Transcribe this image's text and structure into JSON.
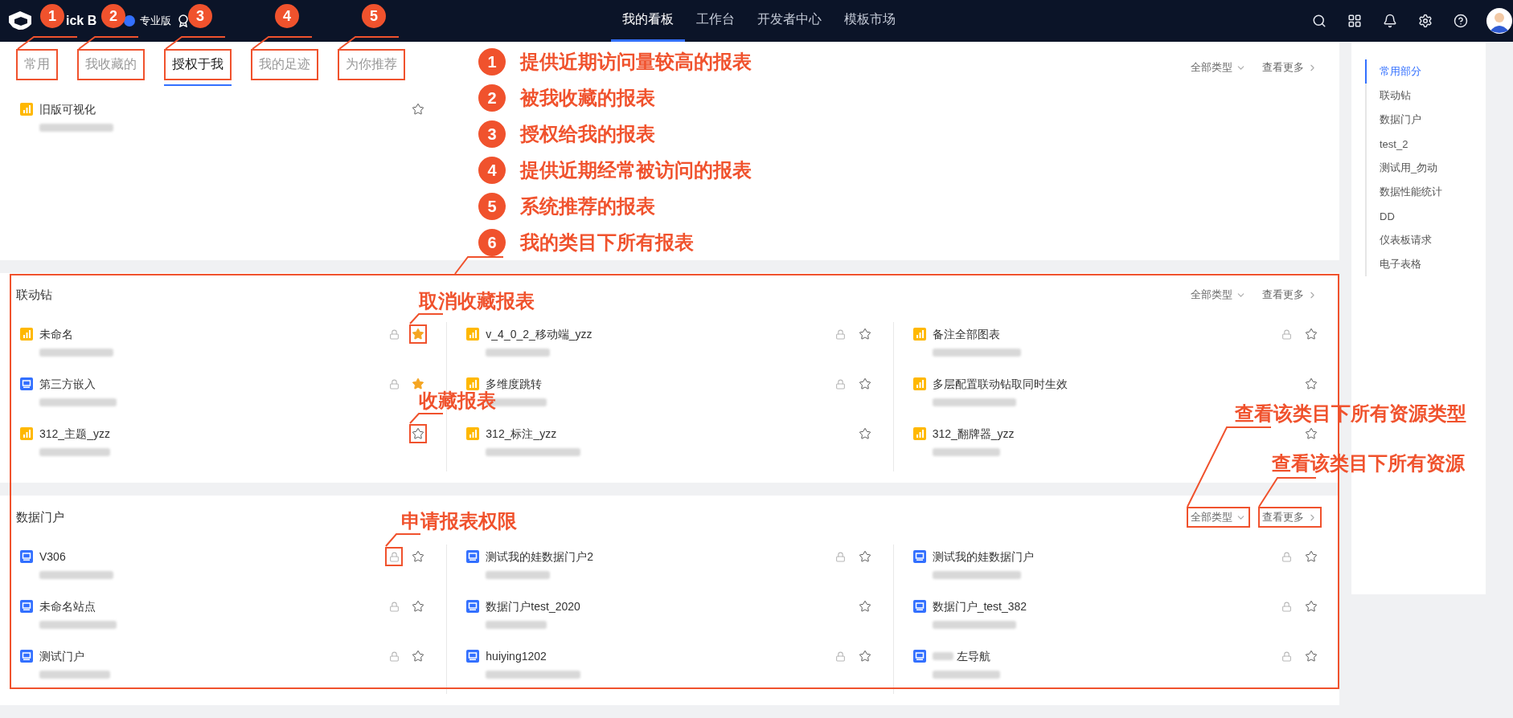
{
  "top_bar": {
    "logo_text": "ick B",
    "edition": "专业版",
    "nav": [
      {
        "label": "我的看板",
        "selected": true
      },
      {
        "label": "工作台",
        "selected": false
      },
      {
        "label": "开发者中心",
        "selected": false
      },
      {
        "label": "模板市场",
        "selected": false
      }
    ]
  },
  "common": {
    "tabs": [
      {
        "label": "常用",
        "selected": false,
        "marked": true,
        "badge": "1"
      },
      {
        "label": "我收藏的",
        "selected": false,
        "marked": true,
        "badge": "2"
      },
      {
        "label": "授权于我",
        "selected": true,
        "marked": true,
        "badge": "3"
      },
      {
        "label": "我的足迹",
        "selected": false,
        "marked": true,
        "badge": "4"
      },
      {
        "label": "为你推荐",
        "selected": false,
        "marked": true,
        "badge": "5"
      }
    ],
    "filter": {
      "label": "全部类型",
      "boxed": false
    },
    "more": {
      "label": "查看更多",
      "boxed": false
    },
    "items": [
      {
        "name": "旧版可视化",
        "kind": "chart",
        "locked": false,
        "favorite": false
      }
    ]
  },
  "legend": [
    {
      "number": "1",
      "text": "提供近期访问量较高的报表"
    },
    {
      "number": "2",
      "text": "被我收藏的报表"
    },
    {
      "number": "3",
      "text": "授权给我的报表"
    },
    {
      "number": "4",
      "text": "提供近期经常被访问的报表"
    },
    {
      "number": "5",
      "text": "系统推荐的报表"
    },
    {
      "number": "6",
      "text": "我的类目下所有报表"
    }
  ],
  "sections": [
    {
      "title": "联动钻",
      "filter": {
        "label": "全部类型",
        "boxed": false
      },
      "more": {
        "label": "查看更多",
        "boxed": false
      },
      "items": [
        {
          "name": "未命名",
          "kind": "chart",
          "locked": true,
          "favorite": true,
          "star_boxed": true,
          "callout": "取消收藏报表"
        },
        {
          "name": "v_4_0_2_移动端_yzz",
          "kind": "chart",
          "locked": true,
          "favorite": false
        },
        {
          "name": "备注全部图表",
          "kind": "chart",
          "locked": true,
          "favorite": false
        },
        {
          "name": "第三方嵌入",
          "kind": "portal",
          "locked": true,
          "favorite": true
        },
        {
          "name": "多维度跳转",
          "kind": "chart",
          "locked": true,
          "favorite": false
        },
        {
          "name": "多层配置联动钻取同时生效",
          "kind": "chart",
          "locked": false,
          "favorite": false
        },
        {
          "name": "312_主题_yzz",
          "kind": "chart",
          "locked": false,
          "favorite": false,
          "star_boxed": true,
          "callout": "收藏报表"
        },
        {
          "name": "312_标注_yzz",
          "kind": "chart",
          "locked": false,
          "favorite": false
        },
        {
          "name": "312_翻牌器_yzz",
          "kind": "chart",
          "locked": false,
          "favorite": false
        }
      ]
    },
    {
      "title": "数据门户",
      "filter": {
        "label": "全部类型",
        "boxed": true,
        "note": "查看该类目下所有资源类型"
      },
      "more": {
        "label": "查看更多",
        "boxed": true,
        "note": "查看该类目下所有资源"
      },
      "items": [
        {
          "name": "V306",
          "kind": "portal",
          "locked": true,
          "favorite": false,
          "lock_boxed": true,
          "callout": "申请报表权限"
        },
        {
          "name": "测试我的娃数据门户2",
          "kind": "portal",
          "locked": true,
          "favorite": false
        },
        {
          "name": "测试我的娃数据门户",
          "kind": "portal",
          "locked": true,
          "favorite": false
        },
        {
          "name": "未命名站点",
          "kind": "portal",
          "locked": true,
          "favorite": false
        },
        {
          "name": "数据门户test_2020",
          "kind": "portal",
          "locked": false,
          "favorite": false
        },
        {
          "name": "数据门户_test_382",
          "kind": "portal",
          "locked": true,
          "favorite": false
        },
        {
          "name": "测试门户",
          "kind": "portal",
          "locked": true,
          "favorite": false
        },
        {
          "name": "huiying1202",
          "kind": "portal",
          "locked": true,
          "favorite": false
        },
        {
          "name": "左导航",
          "kind": "portal",
          "locked": true,
          "favorite": false,
          "prefix_hidden": true
        }
      ]
    }
  ],
  "sidebar": {
    "items": [
      {
        "label": "常用部分",
        "selected": true
      },
      {
        "label": "联动钻",
        "selected": false
      },
      {
        "label": "数据门户",
        "selected": false
      },
      {
        "label": "test_2",
        "selected": false
      },
      {
        "label": "测试用_勿动",
        "selected": false
      },
      {
        "label": "数据性能统计",
        "selected": false
      },
      {
        "label": "DD",
        "selected": false
      },
      {
        "label": "仪表板请求",
        "selected": false
      },
      {
        "label": "电子表格",
        "selected": false
      }
    ]
  }
}
